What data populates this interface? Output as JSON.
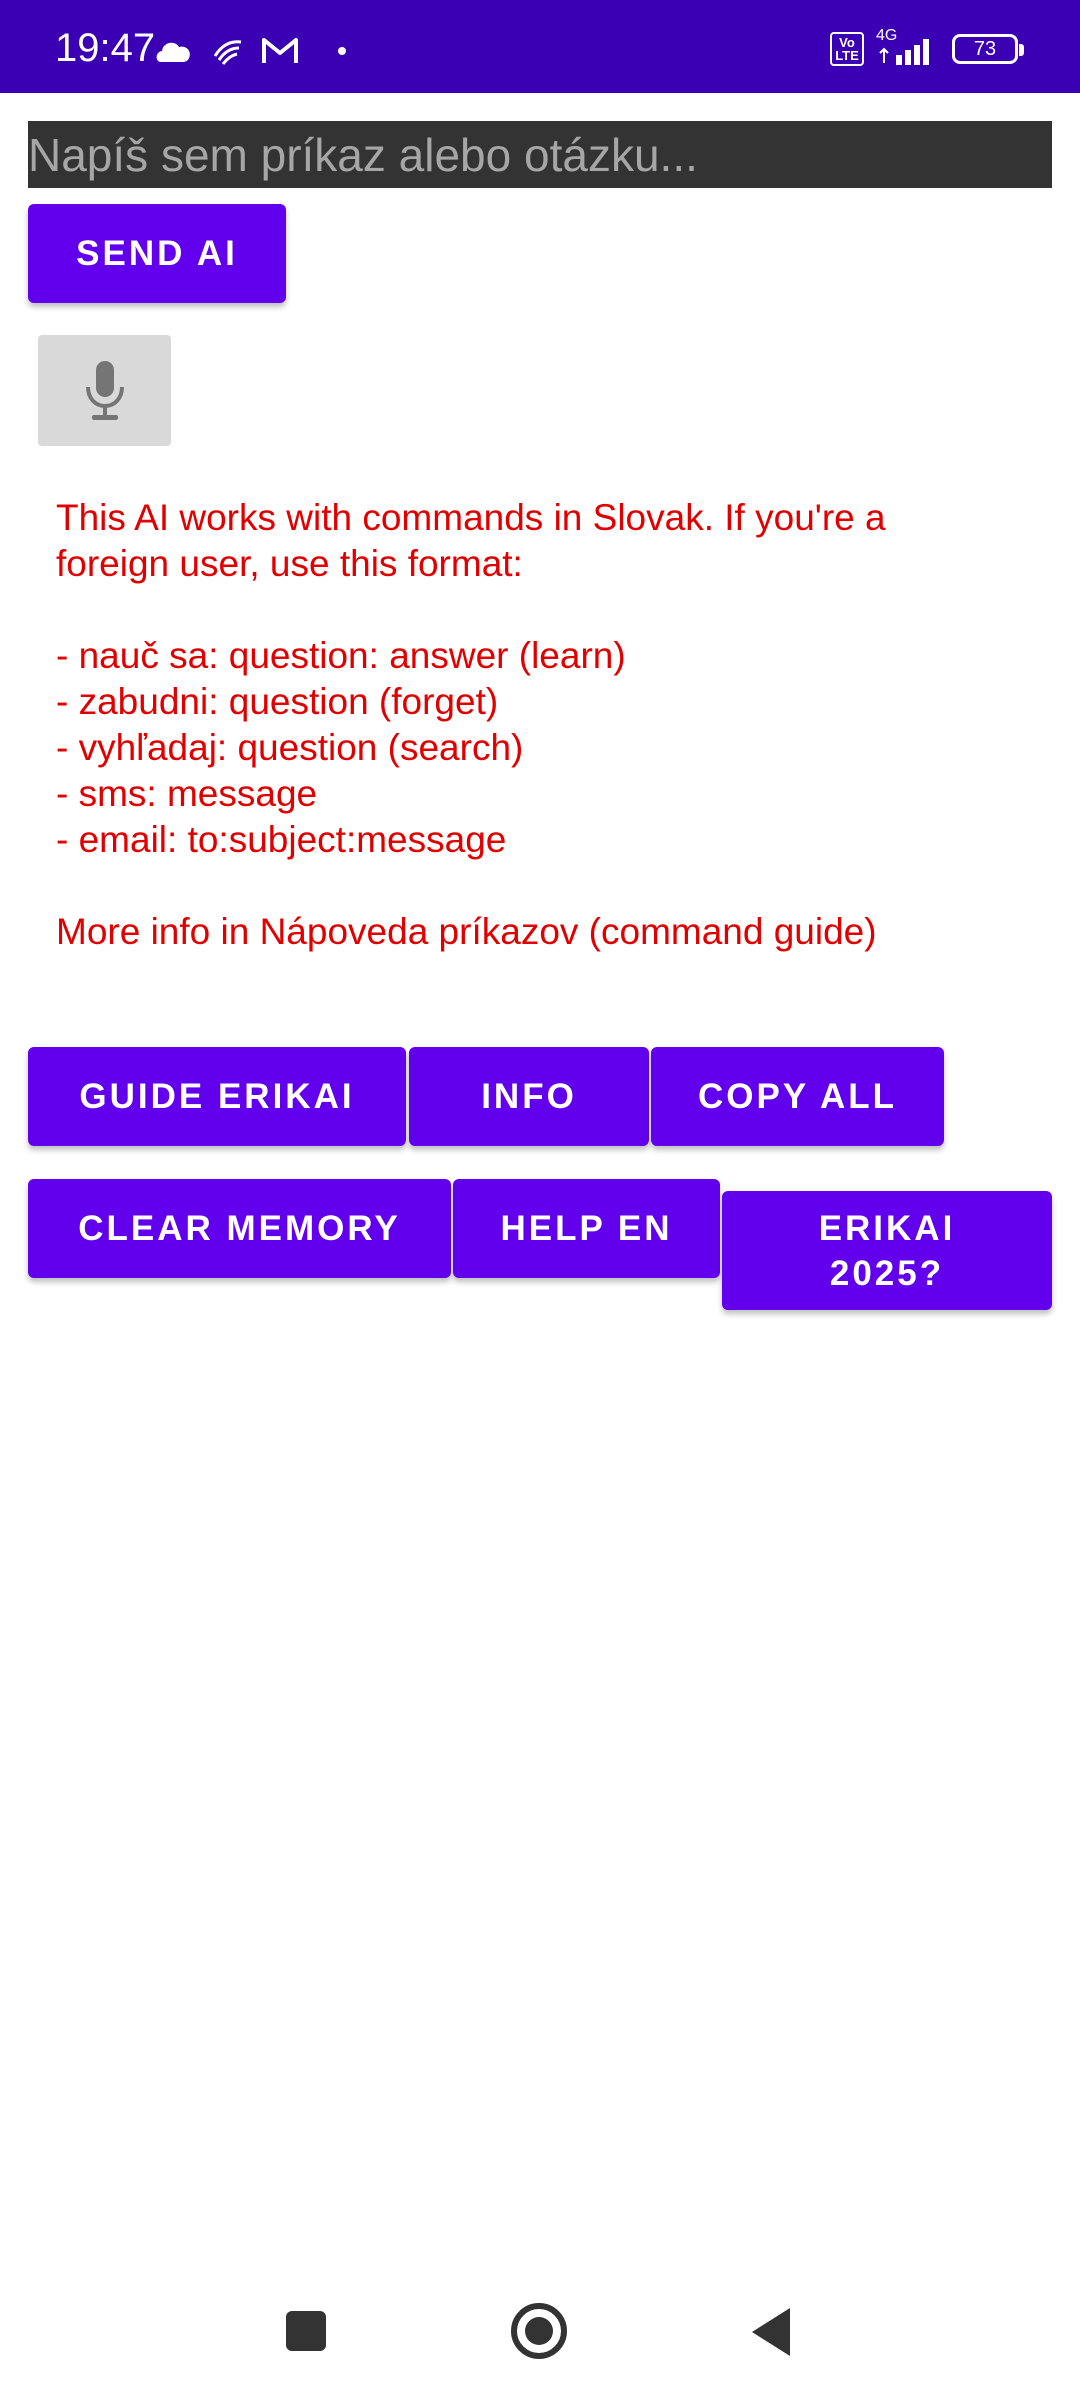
{
  "status_bar": {
    "time": "19:47",
    "network_label": "4G",
    "volte_label": "Vo LTE",
    "battery": "73",
    "icons": [
      "cloud-icon",
      "weather-icon",
      "gmail-icon",
      "dot-icon",
      "volte-icon",
      "signal-icon",
      "battery-icon"
    ],
    "background": "#3b00b3"
  },
  "input": {
    "placeholder": "Napíš sem príkaz alebo otázku..."
  },
  "buttons": {
    "send": "SEND AI",
    "guide": "GUIDE ERIKAI",
    "info": "INFO",
    "copy_all": "COPY ALL",
    "clear_memory": "CLEAR MEMORY",
    "help_en": "HELP EN",
    "erikai_2025": "ERIKAI 2025?"
  },
  "mic": {
    "icon": "microphone-icon"
  },
  "info_text": {
    "line1": "This AI works with commands in Slovak. If you're a",
    "line2": "foreign user, use this format:",
    "cmd1": "- nauč sa: question: answer (learn)",
    "cmd2": "- zabudni: question (forget)",
    "cmd3": "- vyhľadaj: question (search)",
    "cmd4": "- sms: message",
    "cmd5": "- email: to:subject:message",
    "footer": "More info in Nápoveda príkazov (command guide)"
  },
  "colors": {
    "accent": "#6200ee",
    "info_text": "#e00000",
    "input_bg": "#333333"
  }
}
